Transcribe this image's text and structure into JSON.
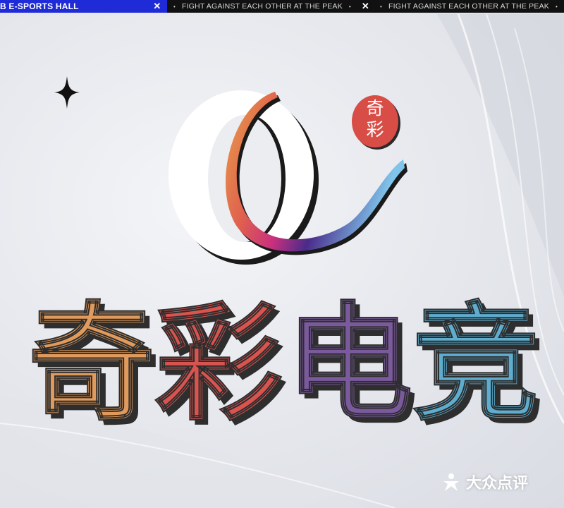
{
  "banner": {
    "left_text": "B E-SPORTS HALL",
    "close_glyph": "✕",
    "slogan_1": "FIGHT AGAINST EACH OTHER AT THE PEAK",
    "slogan_2": "FIGHT AGAINST EACH OTHER AT THE PEAK",
    "dot_glyph": "•",
    "colors": {
      "blue": "#1f2bd6",
      "dark": "#111111"
    }
  },
  "logo": {
    "icon": "q-swirl-logo-icon",
    "seal_char_1": "奇",
    "seal_char_2": "彩",
    "seal_color": "#d84d46"
  },
  "title": {
    "chars": [
      {
        "text": "奇",
        "color": "#e09a5c"
      },
      {
        "text": "彩",
        "color": "#d9534f"
      },
      {
        "text": "电",
        "color": "#7a5a9c"
      },
      {
        "text": "竞",
        "color": "#5eadcf"
      }
    ]
  },
  "watermark": {
    "icon": "dianping-logo-icon",
    "text": "大众点评"
  },
  "decor": {
    "sparkle_icon": "sparkle-icon"
  }
}
